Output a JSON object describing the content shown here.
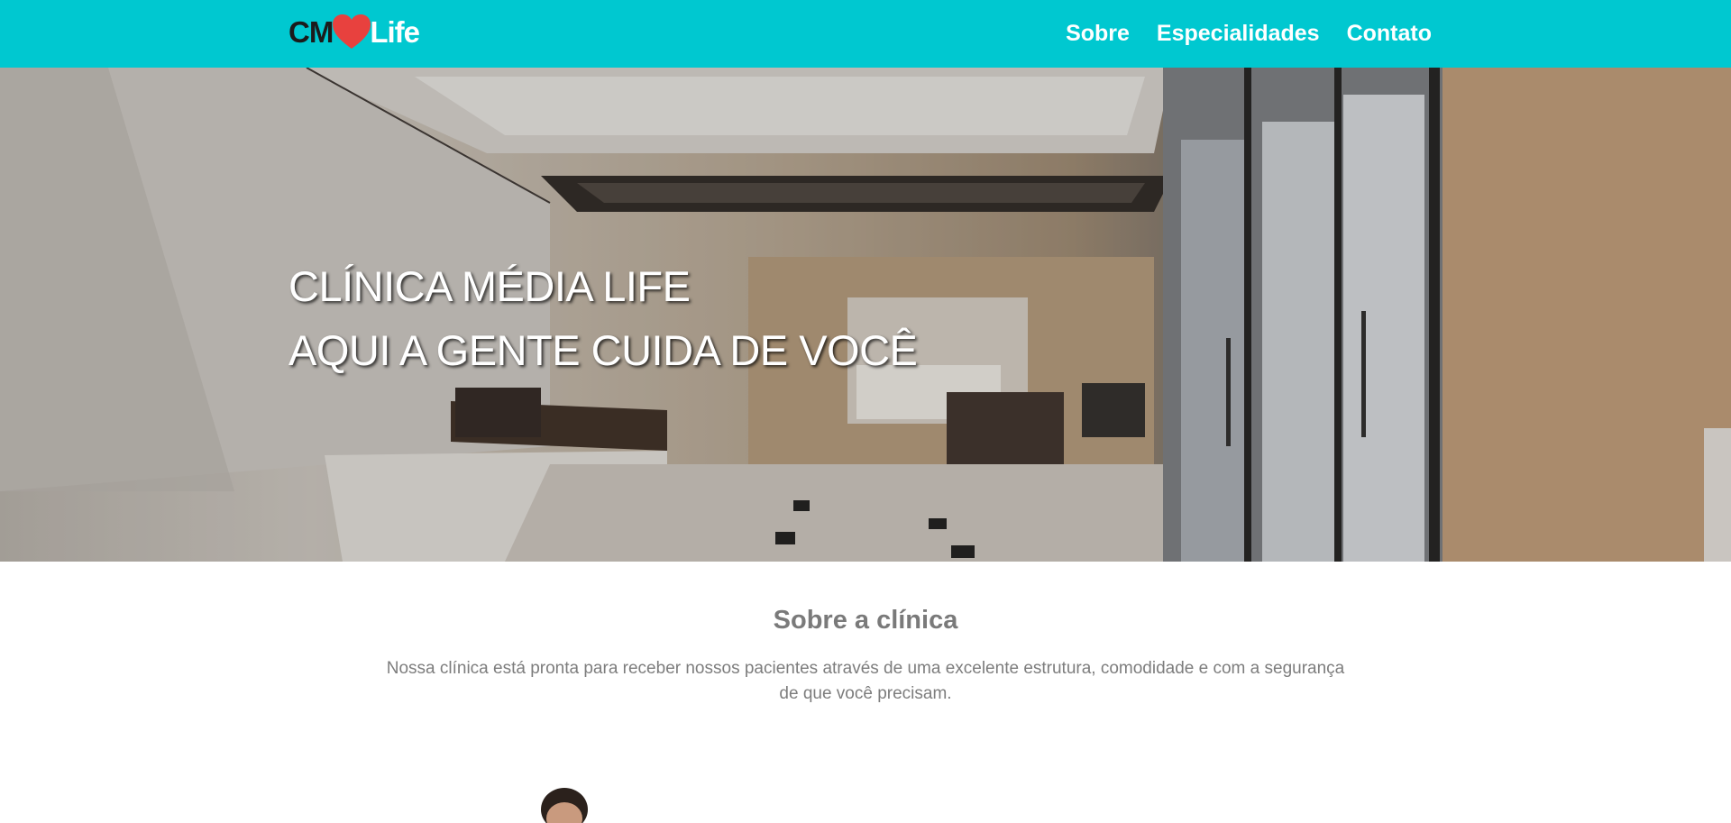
{
  "header": {
    "logo": {
      "prefix": "CM",
      "suffix": "Life",
      "icon": "heart-icon"
    },
    "nav": [
      {
        "label": "Sobre"
      },
      {
        "label": "Especialidades"
      },
      {
        "label": "Contato"
      }
    ]
  },
  "hero": {
    "line1": "CLÍNICA MÉDIA LIFE",
    "line2": "AQUI A GENTE CUIDA DE VOCÊ"
  },
  "about": {
    "title": "Sobre a clínica",
    "text": "Nossa clínica está pronta para receber nossos pacientes através de uma excelente estrutura, comodidade e com a segurança de que você precisam."
  },
  "colors": {
    "header_bg": "#00c8d0",
    "heart": "#e8413e",
    "text_muted": "#7a7a7a"
  }
}
